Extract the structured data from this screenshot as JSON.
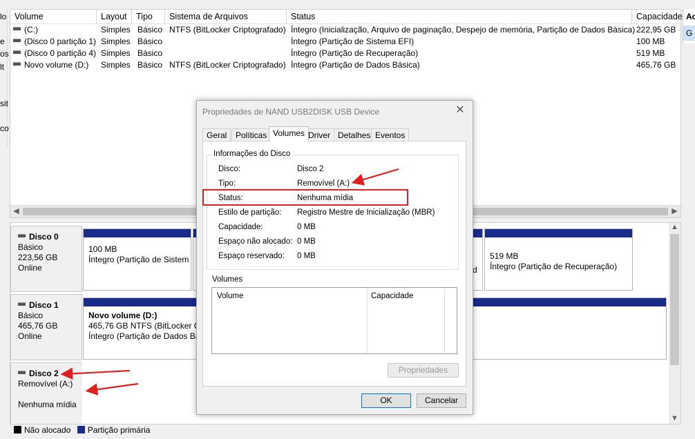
{
  "left_strip": [
    "lo",
    "e",
    "os",
    "lt",
    "sit",
    "co"
  ],
  "volume_list": {
    "columns": [
      "Volume",
      "Layout",
      "Tipo",
      "Sistema de Arquivos",
      "Status",
      "Capacidade"
    ],
    "rows": [
      {
        "volume": "(C:)",
        "layout": "Simples",
        "tipo": "Básico",
        "fs": "NTFS (BitLocker Criptografado)",
        "status": "Íntegro (Inicialização, Arquivo de paginação, Despejo de memória, Partição de Dados Básica)",
        "cap": "222,95 GB"
      },
      {
        "volume": "(Disco 0 partição 1)",
        "layout": "Simples",
        "tipo": "Básico",
        "fs": "",
        "status": "Íntegro (Partição de Sistema EFI)",
        "cap": "100 MB"
      },
      {
        "volume": "(Disco 0 partição 4)",
        "layout": "Simples",
        "tipo": "Básico",
        "fs": "",
        "status": "Íntegro (Partição de Recuperação)",
        "cap": "519 MB"
      },
      {
        "volume": "Novo volume (D:)",
        "layout": "Simples",
        "tipo": "Básico",
        "fs": "NTFS (BitLocker Criptografado)",
        "status": "Íntegro (Partição de Dados Básica)",
        "cap": "465,76 GB"
      }
    ]
  },
  "right_strip": {
    "top": "Ac",
    "item": "G"
  },
  "disks": [
    {
      "name": "Disco 0",
      "type": "Básico",
      "size": "223,56 GB",
      "state": "Online"
    },
    {
      "name": "Disco 1",
      "type": "Básico",
      "size": "465,76 GB",
      "state": "Online"
    },
    {
      "name": "Disco 2",
      "type": "Removível (A:)",
      "size": "",
      "state": "Nenhuma mídia"
    }
  ],
  "partitions": {
    "d0p1": {
      "line1": "100 MB",
      "line2": "Íntegro (Partição de Sistem"
    },
    "d0p_mid_sliver": {
      "line2": "d"
    },
    "d0p4": {
      "line1": "519 MB",
      "line2": "Íntegro (Partição de Recuperação)"
    },
    "d1p1": {
      "title": "Novo volume  (D:)",
      "line1": "465,76 GB NTFS (BitLocker Crip",
      "line2": "Íntegro (Partição de Dados Bás"
    }
  },
  "legend": [
    {
      "label": "Não alocado",
      "color": "#000000"
    },
    {
      "label": "Partição primária",
      "color": "#1a2b8a"
    }
  ],
  "dialog": {
    "title": "Propriedades de NAND USB2DISK USB Device",
    "close": "✕",
    "tabs": [
      "Geral",
      "Políticas",
      "Volumes",
      "Driver",
      "Detalhes",
      "Eventos"
    ],
    "group_title": "Informações do Disco",
    "fields": [
      {
        "label": "Disco:",
        "value": "Disco 2"
      },
      {
        "label": "Tipo:",
        "value": "Removível (A:)"
      },
      {
        "label": "Status:",
        "value": "Nenhuma mídia"
      },
      {
        "label": "Estilo de partição:",
        "value": "Registro Mestre de Inicialização (MBR)"
      },
      {
        "label": "Capacidade:",
        "value": "0 MB"
      },
      {
        "label": "Espaço não alocado:",
        "value": "0 MB"
      },
      {
        "label": "Espaço reservado:",
        "value": "0 MB"
      }
    ],
    "volumes_title": "Volumes",
    "volumes_columns": [
      "Volume",
      "Capacidade"
    ],
    "props_button": "Propriedades",
    "ok": "OK",
    "cancel": "Cancelar"
  },
  "annotation_color": "#e02020"
}
